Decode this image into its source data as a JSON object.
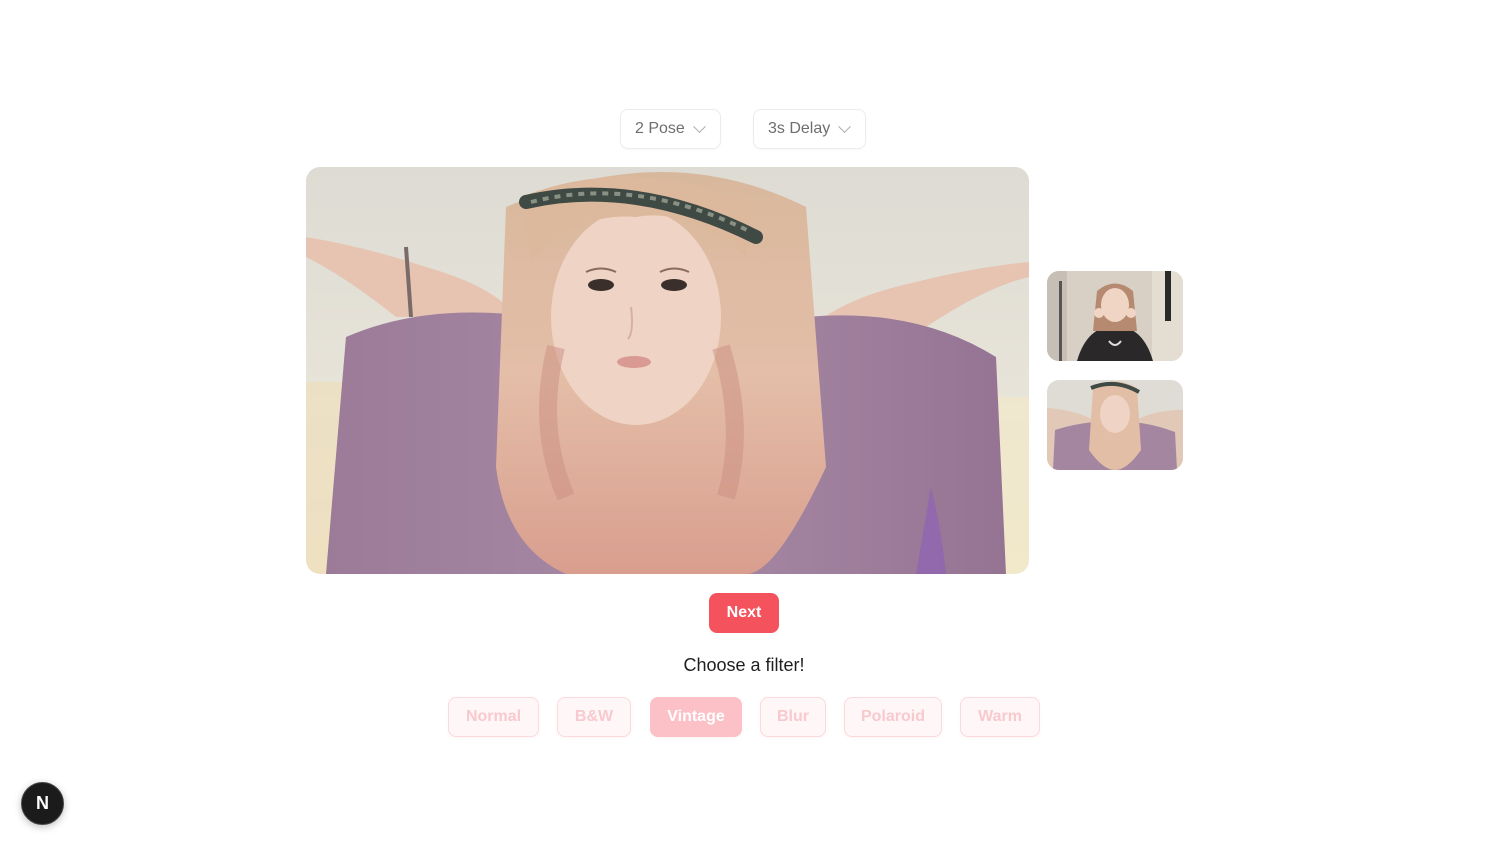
{
  "controls": {
    "pose_select": {
      "value": "2 Pose"
    },
    "delay_select": {
      "value": "3s Delay"
    }
  },
  "main_photo": {
    "description": "portrait photo with vintage filter",
    "colors": {
      "background": "#dcdad2",
      "shirt": "#a07f9c",
      "hair": "#e7bfa6",
      "skin": "#efd2c3"
    }
  },
  "thumbnails": [
    {
      "name": "photo-1"
    },
    {
      "name": "photo-2"
    }
  ],
  "next_button": {
    "label": "Next",
    "color": "#f4535d"
  },
  "filter_section": {
    "title": "Choose a filter!",
    "options": [
      {
        "label": "Normal",
        "active": false
      },
      {
        "label": "B&W",
        "active": false
      },
      {
        "label": "Vintage",
        "active": true
      },
      {
        "label": "Blur",
        "active": false
      },
      {
        "label": "Polaroid",
        "active": false
      },
      {
        "label": "Warm",
        "active": false
      }
    ]
  },
  "dev_badge": {
    "label": "N",
    "icon": "nextjs-logo-icon"
  }
}
